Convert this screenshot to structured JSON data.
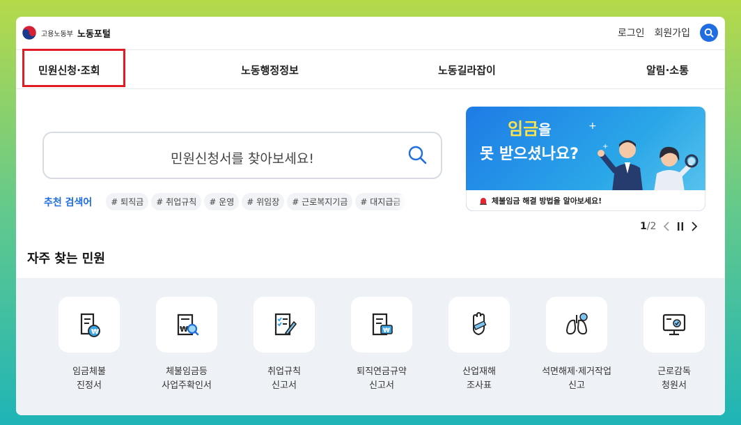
{
  "header": {
    "logo_small": "고용노동부",
    "logo_big": "노동포털",
    "login": "로그인",
    "signup": "회원가입"
  },
  "nav": [
    "민원신청·조회",
    "노동행정정보",
    "노동길라잡이",
    "알림·소통"
  ],
  "search": {
    "placeholder": "민원신청서를 찾아보세요!",
    "recommend_label": "추천 검색어",
    "keywords": [
      "# 퇴직금",
      "# 취업규칙",
      "# 운영",
      "# 위임장",
      "# 근로복지기금",
      "# 대지급금"
    ]
  },
  "banner": {
    "line1_highlight": "임금",
    "line1_rest": "을",
    "line2": "못 받으셨나요?",
    "bottom_text": "체불임금 해결 방법을 알아보세요!",
    "pager_current": "1",
    "pager_total": "/2"
  },
  "section": {
    "title": "자주 찾는 민원",
    "services": [
      {
        "line1": "임금체불",
        "line2": "진정서",
        "icon": "wage-document-icon"
      },
      {
        "line1": "체불임금등",
        "line2": "사업주확인서",
        "icon": "wage-confirmation-icon"
      },
      {
        "line1": "취업규칙",
        "line2": "신고서",
        "icon": "rules-checklist-icon"
      },
      {
        "line1": "퇴직연금규약",
        "line2": "신고서",
        "icon": "pension-document-icon"
      },
      {
        "line1": "산업재해",
        "line2": "조사표",
        "icon": "injured-hand-icon"
      },
      {
        "line1": "석면해제·제거작업",
        "line2": "신고",
        "icon": "lungs-icon"
      },
      {
        "line1": "근로감독",
        "line2": "청원서",
        "icon": "monitor-check-icon"
      }
    ]
  },
  "colors": {
    "accent": "#1f6de0",
    "highlight_border": "#e01b24",
    "banner_yellow": "#ffe34d"
  }
}
